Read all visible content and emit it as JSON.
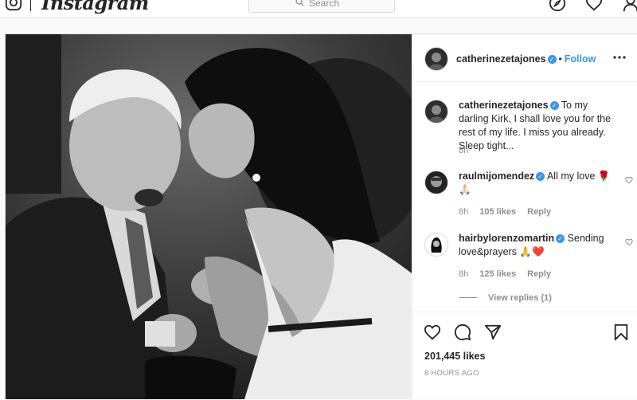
{
  "nav": {
    "brand": "Instagram",
    "search_placeholder": "Search",
    "icons": [
      "instagram-glyph-icon",
      "search-icon",
      "explore-compass-icon",
      "activity-heart-icon",
      "profile-icon"
    ]
  },
  "post": {
    "author": {
      "username": "catherinezetajones",
      "verified": true,
      "dot": "•",
      "follow_label": "Follow"
    },
    "caption": {
      "username": "catherinezetajones",
      "text": "To my darling Kirk, I shall love you for the rest of my life. I miss you already. Sleep tight...",
      "time": "8h"
    },
    "comments": [
      {
        "username": "raulmijomendez",
        "verified": true,
        "text": "All my love 🌹🙏🏻",
        "time": "8h",
        "likes": "105 likes",
        "reply": "Reply"
      },
      {
        "username": "hairbylorenzomartin",
        "verified": true,
        "text": "Sending love&prayers 🙏❤️",
        "time": "8h",
        "likes": "125 likes",
        "reply": "Reply"
      }
    ],
    "view_replies": "View replies (1)",
    "likes_count": "201,445 likes",
    "posted_ago": "8 HOURS AGO"
  },
  "colors": {
    "accent": "#3897f0",
    "text": "#262626",
    "muted": "#8e8e8e",
    "border": "#dbdbdb",
    "heart_red": "#ed4956"
  }
}
